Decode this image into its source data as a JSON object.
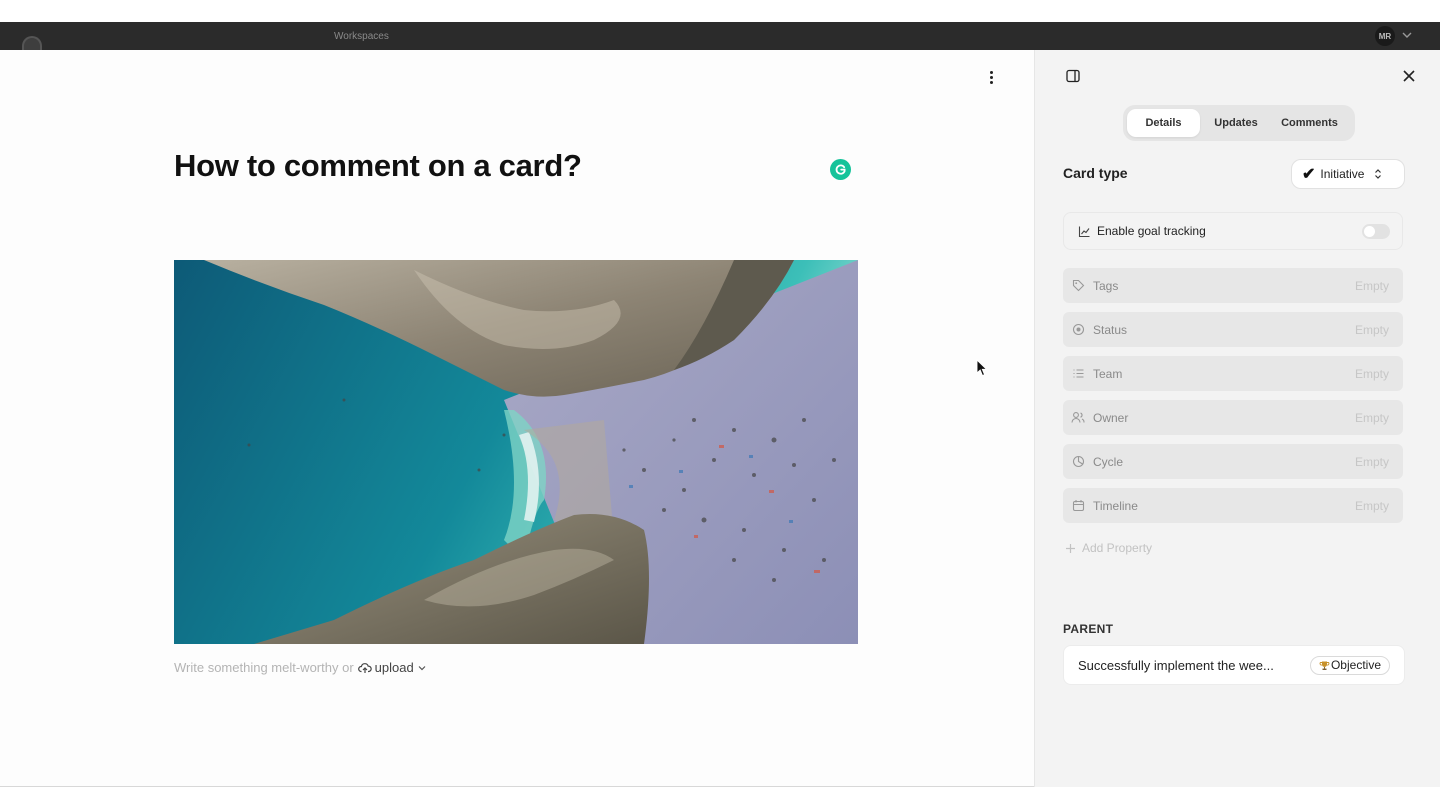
{
  "topbar": {
    "workspace_label": "Workspaces",
    "avatar_initials": "MR"
  },
  "main": {
    "title": "How to comment on a card?",
    "hint_text": "Write something melt-worthy or",
    "upload_label": "upload"
  },
  "panel": {
    "tabs": [
      {
        "label": "Details",
        "active": true
      },
      {
        "label": "Updates",
        "active": false
      },
      {
        "label": "Comments",
        "active": false
      }
    ],
    "card_type_label": "Card type",
    "card_type_value": "Initiative",
    "goal_tracking_label": "Enable goal tracking",
    "goal_tracking_enabled": false,
    "properties": [
      {
        "label": "Tags",
        "value": "Empty",
        "icon": "tag-icon"
      },
      {
        "label": "Status",
        "value": "Empty",
        "icon": "status-icon"
      },
      {
        "label": "Team",
        "value": "Empty",
        "icon": "list-icon"
      },
      {
        "label": "Owner",
        "value": "Empty",
        "icon": "users-icon"
      },
      {
        "label": "Cycle",
        "value": "Empty",
        "icon": "cycle-icon"
      },
      {
        "label": "Timeline",
        "value": "Empty",
        "icon": "calendar-icon"
      }
    ],
    "add_property_label": "Add Property",
    "parent_label": "PARENT",
    "parent_title": "Successfully implement the wee...",
    "parent_badge": "Objective"
  },
  "colors": {
    "grammarly": "#15c39a",
    "panel_bg": "#f3f3f3",
    "topbar": "#2b2b2b"
  }
}
